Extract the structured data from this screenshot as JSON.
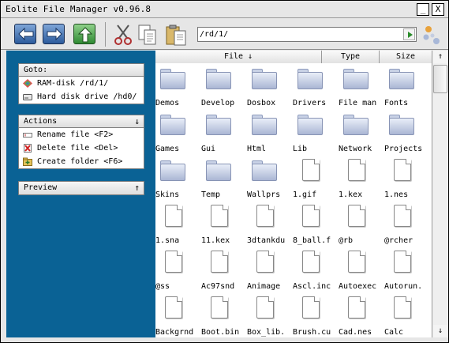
{
  "window": {
    "title": "Eolite File Manager v0.96.8",
    "minimize_label": "_",
    "close_label": "X"
  },
  "toolbar": {
    "buttons": [
      {
        "name": "back",
        "icon": "left-arrow-icon"
      },
      {
        "name": "forward",
        "icon": "right-arrow-icon"
      },
      {
        "name": "up",
        "icon": "up-arrow-icon"
      },
      {
        "name": "cut",
        "icon": "scissors-icon"
      },
      {
        "name": "copy",
        "icon": "copy-icon"
      },
      {
        "name": "paste",
        "icon": "paste-icon"
      }
    ],
    "path": "/rd/1/",
    "accent": "#2c5b9c",
    "go_color": "#2a8c2a"
  },
  "sidebar": {
    "background": "#0a6295",
    "goto": {
      "title": "Goto:",
      "items": [
        {
          "label": "RAM-disk /rd/1/",
          "icon": "ram-disk-icon"
        },
        {
          "label": "Hard disk drive /hd0/",
          "icon": "hard-disk-icon"
        }
      ]
    },
    "actions": {
      "title": "Actions",
      "chevron": "↓",
      "items": [
        {
          "label": "Rename file <F2>",
          "icon": "rename-icon"
        },
        {
          "label": "Delete file <Del>",
          "icon": "delete-icon"
        },
        {
          "label": "Create folder <F6>",
          "icon": "new-folder-icon"
        }
      ]
    },
    "preview": {
      "title": "Preview",
      "chevron": "↑"
    }
  },
  "columns": {
    "file": "File ↓",
    "type": "Type",
    "size": "Size"
  },
  "files": [
    {
      "name": "Demos",
      "kind": "folder"
    },
    {
      "name": "Develop",
      "kind": "folder"
    },
    {
      "name": "Dosbox",
      "kind": "folder"
    },
    {
      "name": "Drivers",
      "kind": "folder"
    },
    {
      "name": "File man",
      "kind": "folder"
    },
    {
      "name": "Fonts",
      "kind": "folder"
    },
    {
      "name": "Games",
      "kind": "folder"
    },
    {
      "name": "Gui",
      "kind": "folder"
    },
    {
      "name": "Html",
      "kind": "folder"
    },
    {
      "name": "Lib",
      "kind": "folder"
    },
    {
      "name": "Network",
      "kind": "folder"
    },
    {
      "name": "Projects",
      "kind": "folder"
    },
    {
      "name": "Skins",
      "kind": "folder"
    },
    {
      "name": "Temp",
      "kind": "folder"
    },
    {
      "name": "Wallprs",
      "kind": "folder"
    },
    {
      "name": "1.gif",
      "kind": "file"
    },
    {
      "name": "1.kex",
      "kind": "file"
    },
    {
      "name": "1.nes",
      "kind": "file"
    },
    {
      "name": "1.sna",
      "kind": "file"
    },
    {
      "name": "11.kex",
      "kind": "file"
    },
    {
      "name": "3dtankdu",
      "kind": "file"
    },
    {
      "name": "8_ball.f",
      "kind": "file"
    },
    {
      "name": "@rb",
      "kind": "file"
    },
    {
      "name": "@rcher",
      "kind": "file"
    },
    {
      "name": "@ss",
      "kind": "file"
    },
    {
      "name": "Ac97snd",
      "kind": "file"
    },
    {
      "name": "Animage",
      "kind": "file"
    },
    {
      "name": "Ascl.inc",
      "kind": "file"
    },
    {
      "name": "Autoexec",
      "kind": "file"
    },
    {
      "name": "Autorun.",
      "kind": "file"
    },
    {
      "name": "Backgrnd",
      "kind": "file"
    },
    {
      "name": "Boot.bin",
      "kind": "file"
    },
    {
      "name": "Box_lib.",
      "kind": "file"
    },
    {
      "name": "Brush.cu",
      "kind": "file"
    },
    {
      "name": "Cad.nes",
      "kind": "file"
    },
    {
      "name": "Calc",
      "kind": "file"
    }
  ],
  "scrollbar": {
    "up": "↑",
    "down": "↓"
  }
}
